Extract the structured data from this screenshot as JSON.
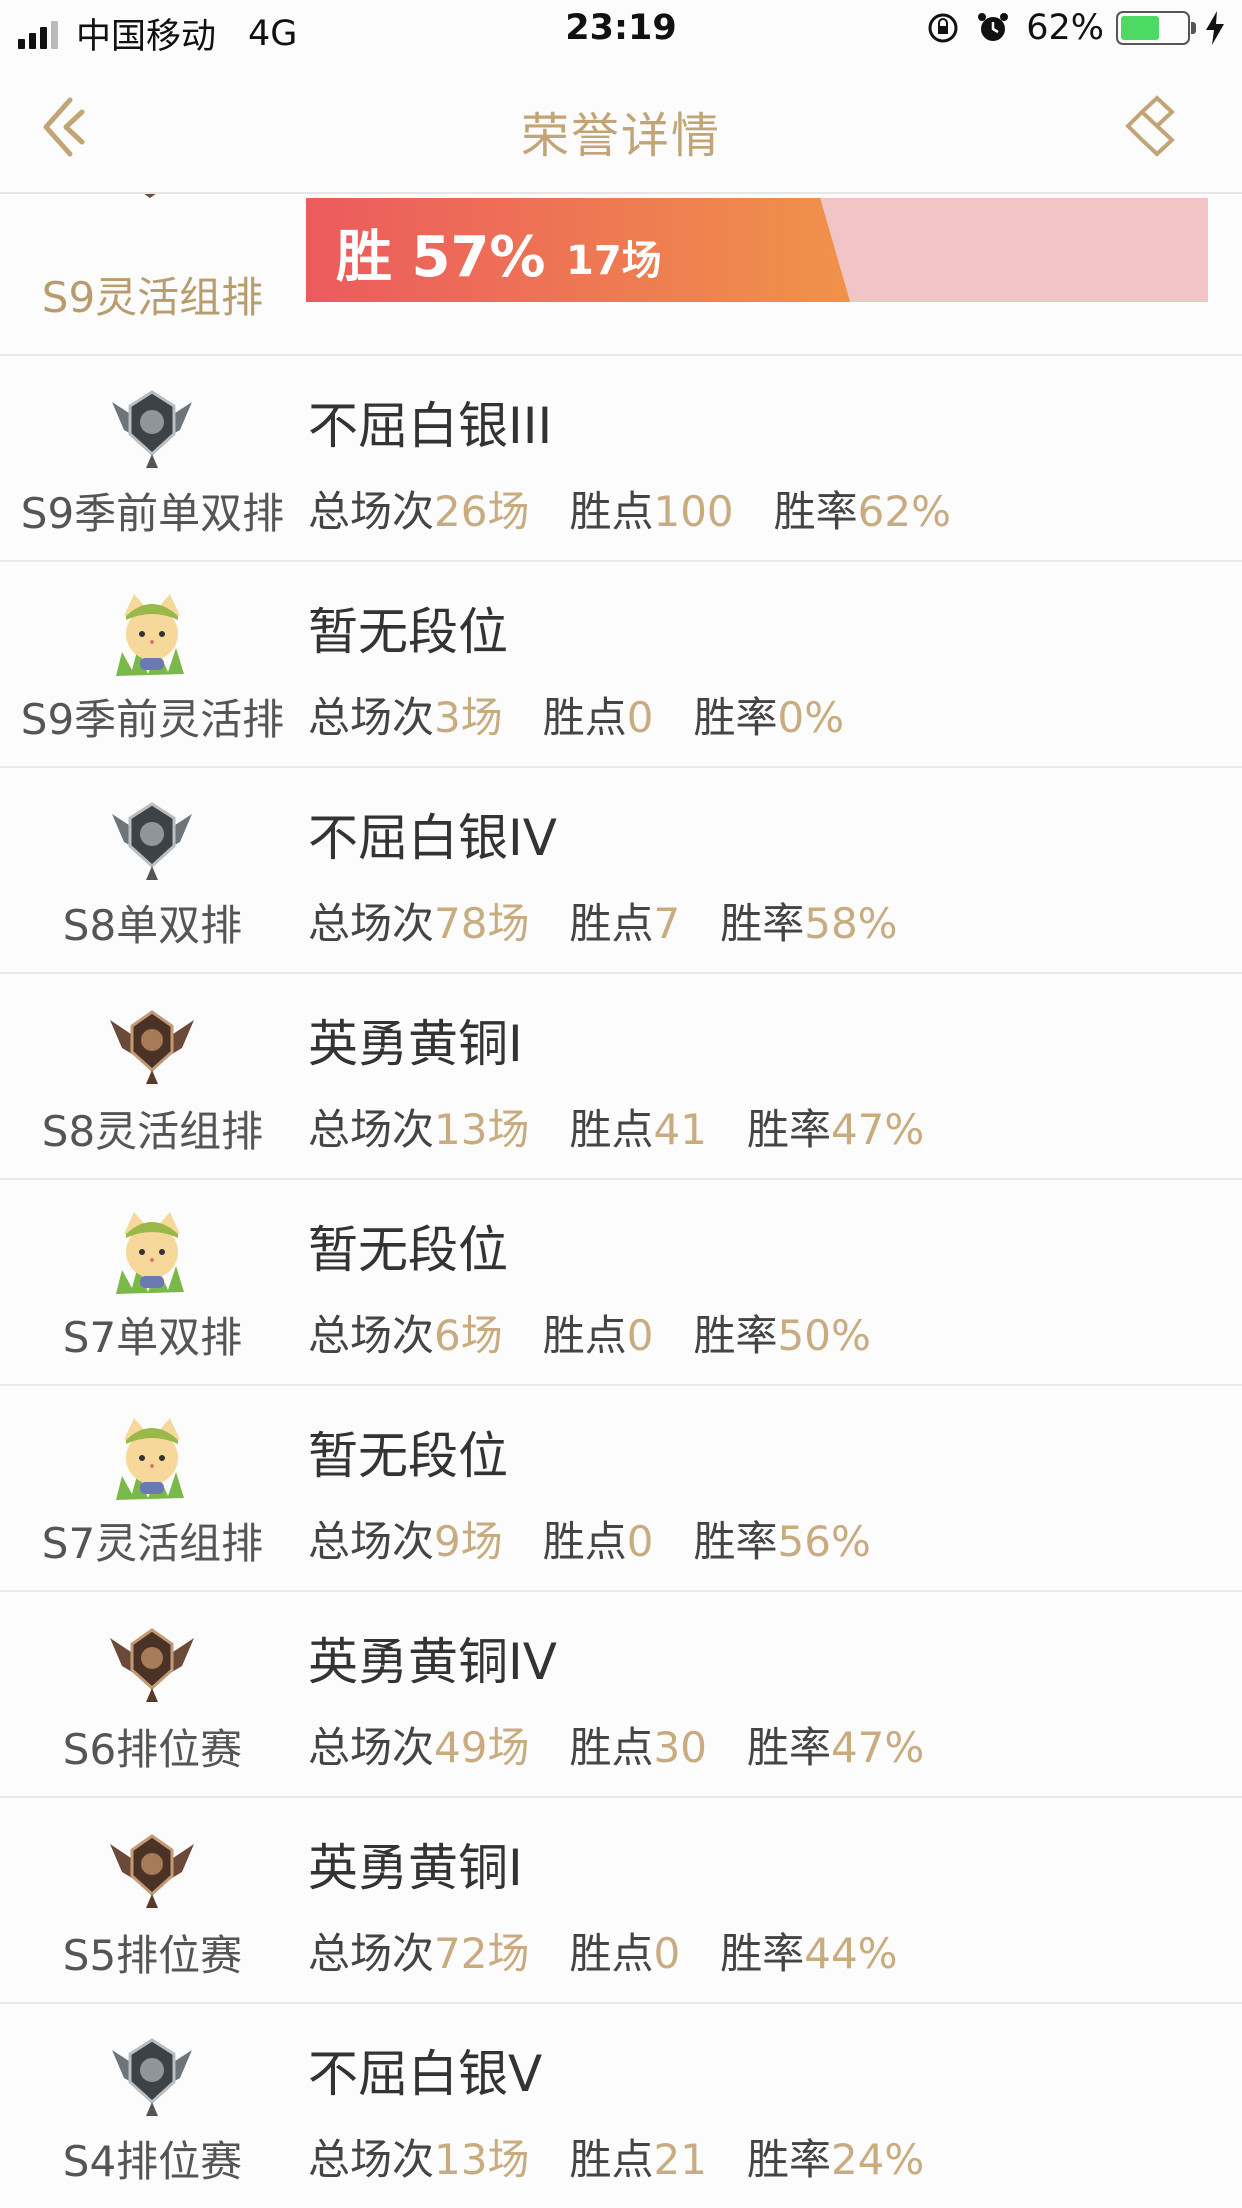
{
  "status_bar": {
    "carrier": "中国移动",
    "network": "4G",
    "time": "23:19",
    "battery": "62%",
    "battery_level": 0.62
  },
  "nav": {
    "title": "荣誉详情"
  },
  "top_entry": {
    "season": "S9灵活组排",
    "win_label": "胜 57%",
    "games_label": "17场",
    "win_rate": 0.57
  },
  "labels": {
    "total_games": "总场次",
    "points": "胜点",
    "win_rate": "胜率"
  },
  "rows": [
    {
      "season": "S9季前单双排",
      "rank": "不屈白银III",
      "badge": "silver-badge-icon",
      "games": "26场",
      "points": "100",
      "rate": "62%"
    },
    {
      "season": "S9季前灵活排",
      "rank": "暂无段位",
      "badge": "unranked-teemo-icon",
      "games": "3场",
      "points": "0",
      "rate": "0%"
    },
    {
      "season": "S8单双排",
      "rank": "不屈白银IV",
      "badge": "silver-badge-icon",
      "games": "78场",
      "points": "7",
      "rate": "58%"
    },
    {
      "season": "S8灵活组排",
      "rank": "英勇黄铜I",
      "badge": "bronze-badge-icon",
      "games": "13场",
      "points": "41",
      "rate": "47%"
    },
    {
      "season": "S7单双排",
      "rank": "暂无段位",
      "badge": "unranked-teemo-icon",
      "games": "6场",
      "points": "0",
      "rate": "50%"
    },
    {
      "season": "S7灵活组排",
      "rank": "暂无段位",
      "badge": "unranked-teemo-icon",
      "games": "9场",
      "points": "0",
      "rate": "56%"
    },
    {
      "season": "S6排位赛",
      "rank": "英勇黄铜IV",
      "badge": "bronze-badge-icon",
      "games": "49场",
      "points": "30",
      "rate": "47%"
    },
    {
      "season": "S5排位赛",
      "rank": "英勇黄铜I",
      "badge": "bronze-badge-icon",
      "games": "72场",
      "points": "0",
      "rate": "44%"
    },
    {
      "season": "S4排位赛",
      "rank": "不屈白银V",
      "badge": "silver-badge-icon",
      "games": "13场",
      "points": "21",
      "rate": "24%"
    }
  ],
  "colors": {
    "accent": "#c2a477",
    "win_start": "#ec5a5e",
    "win_end": "#f0924a",
    "loss": "#f1c4c6"
  }
}
